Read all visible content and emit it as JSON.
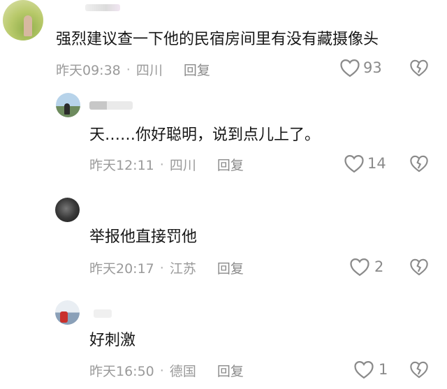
{
  "comments": [
    {
      "text": "强烈建议查一下他的民宿房间里有没有藏摄像头",
      "time": "昨天09:38",
      "location": "四川",
      "reply": "回复",
      "likes": "93"
    },
    {
      "text": "天……你好聪明，说到点儿上了。",
      "time": "昨天12:11",
      "location": "四川",
      "reply": "回复",
      "likes": "14"
    },
    {
      "text": "举报他直接罚他",
      "time": "昨天20:17",
      "location": "江苏",
      "reply": "回复",
      "likes": "2"
    },
    {
      "text": "好刺激",
      "time": "昨天16:50",
      "location": "德国",
      "reply": "回复",
      "likes": "1"
    }
  ],
  "icons": {
    "like": "heart-outline-icon",
    "dislike": "broken-heart-icon"
  },
  "colors": {
    "text": "#161616",
    "meta": "#9a9a9a",
    "icon": "#8a8a8a"
  }
}
